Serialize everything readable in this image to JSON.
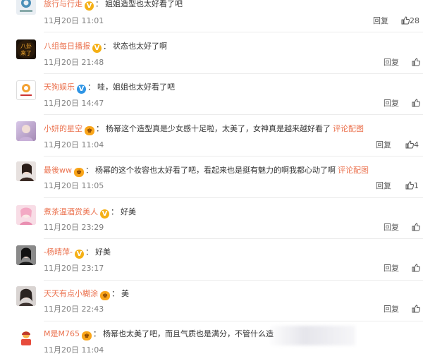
{
  "comments": [
    {
      "name": "旅行与行走",
      "badge": "v-gold",
      "text": "姐姐造型也太好看了吧",
      "link": "",
      "time": "11月20日 11:01",
      "reply": "回复",
      "likes": "28",
      "avatar": "travel-logo"
    },
    {
      "name": "八组每日播报",
      "badge": "v-gold",
      "text": "状态也太好了啊",
      "link": "",
      "time": "11月20日 21:48",
      "reply": "回复",
      "likes": "",
      "avatar": "bagua-logo"
    },
    {
      "name": "天狗娱乐",
      "badge": "v-blue",
      "text": "哇，姐姐也太好看了吧",
      "link": "",
      "time": "11月20日 14:47",
      "reply": "回复",
      "likes": "",
      "avatar": "tiangou-logo"
    },
    {
      "name": "小妍的星空",
      "badge": "crown",
      "text": "杨幂这个造型真是少女感十足啦，太美了，女神真是越来越好看了",
      "link": "评论配图",
      "time": "11月20日 11:04",
      "reply": "回复",
      "likes": "4",
      "avatar": "user-photo"
    },
    {
      "name": "最後ww",
      "badge": "crown",
      "text": "杨幂的这个妆容也太好看了吧，看起来也是挺有魅力的啊我都心动了啊",
      "link": "评论配图",
      "time": "11月20日 11:05",
      "reply": "回复",
      "likes": "1",
      "avatar": "user-photo"
    },
    {
      "name": "煮茶温酒赏美人",
      "badge": "v-gold",
      "text": "好美",
      "link": "",
      "time": "11月20日 23:29",
      "reply": "回复",
      "likes": "",
      "avatar": "user-photo"
    },
    {
      "name": "-杨晴萍-",
      "badge": "v-gold",
      "text": "好美",
      "link": "",
      "time": "11月20日 23:17",
      "reply": "回复",
      "likes": "",
      "avatar": "user-photo"
    },
    {
      "name": "天天有点小糊涂",
      "badge": "crown",
      "text": "美",
      "link": "",
      "time": "11月20日 22:43",
      "reply": "回复",
      "likes": "",
      "avatar": "user-photo"
    },
    {
      "name": "M是M765",
      "badge": "crown",
      "text": "杨幂也太美了吧，而且气质也是满分，不管什么造",
      "link": "",
      "time": "11月20日 11:04",
      "reply": "",
      "likes": "",
      "avatar": "user-photo"
    }
  ],
  "colors": {
    "name": "#eb7350",
    "time": "#808080",
    "vip": "#f5b015",
    "verified": "#2f95e5"
  }
}
